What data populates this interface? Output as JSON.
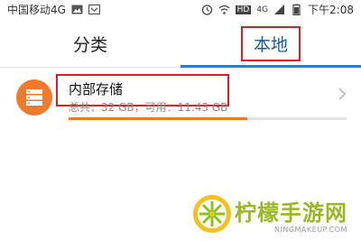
{
  "status_bar": {
    "carrier": "中国移动4G",
    "hd_badge": "HD",
    "signal_badge": "4G",
    "time": "下午2:08"
  },
  "tabs": [
    {
      "label": "分类",
      "selected": false
    },
    {
      "label": "本地",
      "selected": true
    }
  ],
  "storage_item": {
    "title": "内部存储",
    "subtitle": "总共：32 GB，可用：11.43 GB",
    "total_gb": 32,
    "free_gb": 11.43,
    "icon": "storage-icon",
    "accent": "#f07a2c"
  },
  "watermark": {
    "text": "柠檬手游网",
    "subtext": "NINGMAKEUP.COM"
  },
  "colors": {
    "active_tab": "#1a5e9a",
    "tab_indicator": "#2a80c8",
    "annotation": "#d91f2e"
  }
}
